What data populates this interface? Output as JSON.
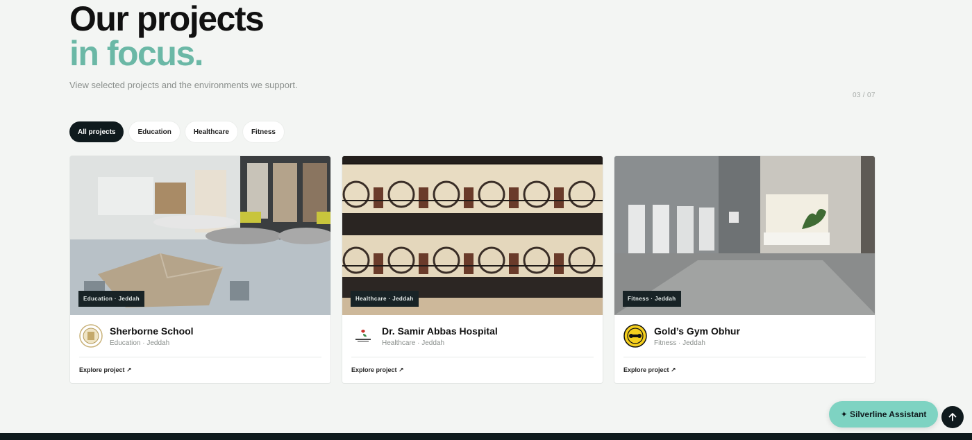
{
  "hero": {
    "title_line1": "Our projects",
    "title_line2": "in focus.",
    "subtitle": "View selected projects and the environments we support."
  },
  "pager": "03 / 07",
  "filters": [
    {
      "label": "All projects",
      "active": true
    },
    {
      "label": "Education",
      "active": false
    },
    {
      "label": "Healthcare",
      "active": false
    },
    {
      "label": "Fitness",
      "active": false
    }
  ],
  "cards": [
    {
      "tag": "Education · Jeddah",
      "title": "Sherborne School",
      "subtitle": "Education · Jeddah",
      "link": "Explore project ↗",
      "logo_icon": "school-crest-icon"
    },
    {
      "tag": "Healthcare · Jeddah",
      "title": "Dr. Samir Abbas Hospital",
      "subtitle": "Healthcare · Jeddah",
      "link": "Explore project ↗",
      "logo_icon": "hospital-logo-icon"
    },
    {
      "tag": "Fitness · Jeddah",
      "title": "Gold’s Gym Obhur",
      "subtitle": "Fitness · Jeddah",
      "link": "Explore project ↗",
      "logo_icon": "golds-gym-logo-icon"
    }
  ],
  "assistant": {
    "icon": "sparkle-icon",
    "label": "✦ Silverline Assistant"
  },
  "scroll_top": {
    "icon": "arrow-up-icon"
  },
  "colors": {
    "accent": "#6bb8a6",
    "dark": "#0f1a1d",
    "assistant": "#7ed3c2",
    "background": "#f3f5f3"
  }
}
